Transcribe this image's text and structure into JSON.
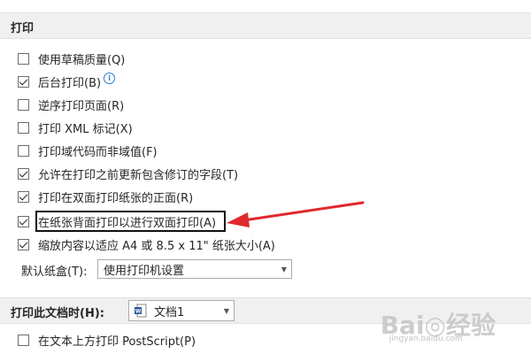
{
  "print_section": {
    "title": "打印",
    "options": [
      {
        "label": "使用草稿质量(Q)",
        "checked": false
      },
      {
        "label": "后台打印(B)",
        "checked": true
      },
      {
        "label": "逆序打印页面(R)",
        "checked": false
      },
      {
        "label": "打印 XML 标记(X)",
        "checked": false
      },
      {
        "label": "打印域代码而非域值(F)",
        "checked": false
      },
      {
        "label": "允许在打印之前更新包含修订的字段(T)",
        "checked": true
      },
      {
        "label": "打印在双面打印纸张的正面(R)",
        "checked": true
      },
      {
        "label": "在纸张背面打印以进行双面打印(A)",
        "checked": true
      },
      {
        "label": "缩放内容以适应 A4 或 8.5 x 11\" 纸张大小(A)",
        "checked": true
      }
    ],
    "default_tray": {
      "label": "默认纸盒(T):",
      "value": "使用打印机设置"
    }
  },
  "doc_section": {
    "title": "打印此文档时(H):",
    "document": "文档1",
    "options": [
      {
        "label": "在文本上方打印 PostScript(P)",
        "checked": false
      }
    ]
  },
  "icons": {
    "info": "info-icon",
    "checkbox_checked": "checkmark-icon",
    "dropdown": "chevron-down-icon",
    "word_doc": "word-document-icon",
    "annotation": "red-arrow"
  },
  "colors": {
    "header_bg": "#f0f0f0",
    "info_blue": "#2b7cd3",
    "annotation_red": "#e0282e"
  },
  "watermark": {
    "brand": "Bai◎经验",
    "url": "jingyan.baidu.com"
  }
}
